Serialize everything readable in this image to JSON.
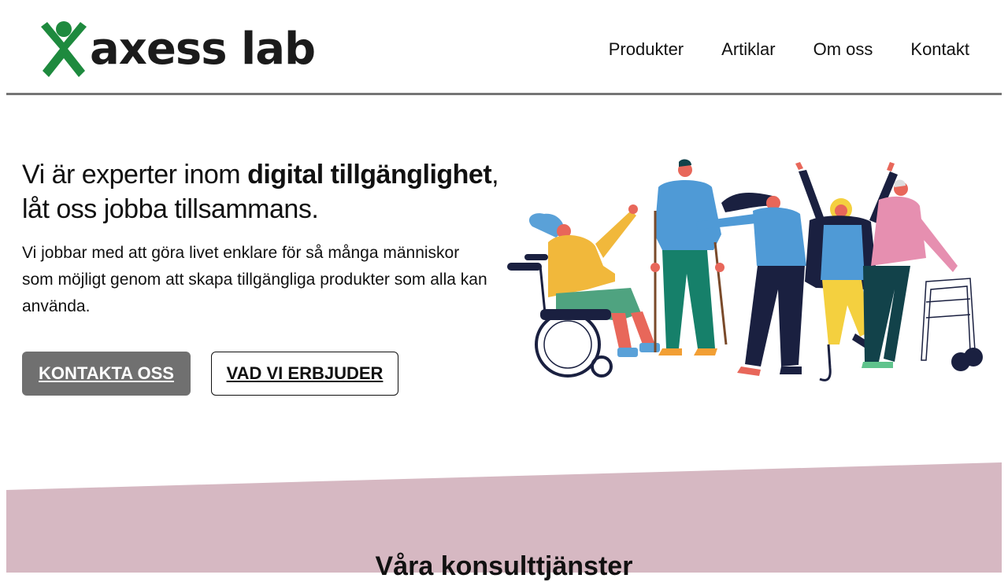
{
  "header": {
    "logo_text": "axess lab",
    "logo_icon": "person-x-logo-icon",
    "brand_color": "#1e8a3e"
  },
  "nav": {
    "items": [
      "Produkter",
      "Artiklar",
      "Om oss",
      "Kontakt"
    ]
  },
  "hero": {
    "title_part1": "Vi är experter inom ",
    "title_bold": "digital tillgänglighet",
    "title_part2": ",",
    "title_line2": "låt oss jobba tillsammans.",
    "description": "Vi jobbar med att göra livet enklare för så många människor som möjligt genom att skapa tillgängliga produkter som alla kan använda.",
    "primary_button": "KONTAKTA OSS",
    "secondary_button": "VAD VI ERBJUDER",
    "illustration_icon": "diverse-people-illustration"
  },
  "services": {
    "heading": "Våra konsulttjänster",
    "band_color": "#d6b8c2"
  },
  "colors": {
    "button_primary": "#707070",
    "header_border": "#757575",
    "text": "#111111"
  }
}
